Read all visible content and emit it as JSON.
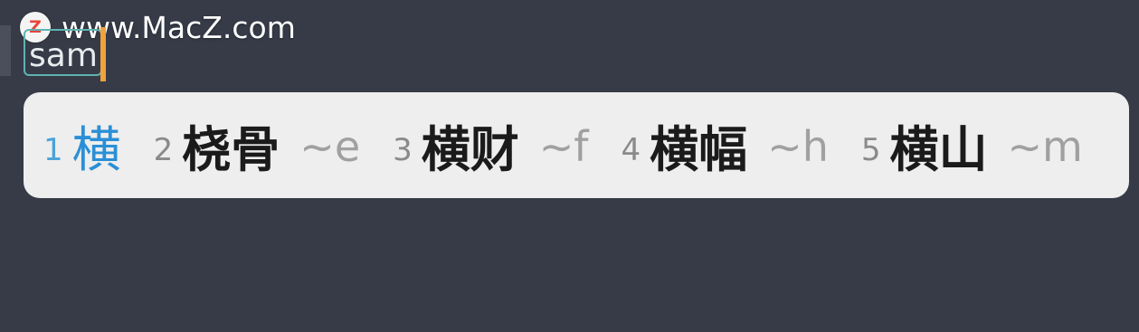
{
  "watermark": {
    "logo_letter": "Z",
    "text": "www.MacZ.com"
  },
  "input": {
    "composing_text": "sam"
  },
  "candidates": [
    {
      "index": "1",
      "word": "横",
      "hint": "",
      "selected": true
    },
    {
      "index": "2",
      "word": "桡骨",
      "hint": "~e",
      "selected": false
    },
    {
      "index": "3",
      "word": "横财",
      "hint": "~f",
      "selected": false
    },
    {
      "index": "4",
      "word": "横幅",
      "hint": "~h",
      "selected": false
    },
    {
      "index": "5",
      "word": "横山",
      "hint": "~m",
      "selected": false
    }
  ],
  "colors": {
    "background": "#363b47",
    "panel": "#eeeeee",
    "selected_candidate": "#2a8fd6",
    "caret": "#f0a23c",
    "composing_border": "#5fb3b0"
  }
}
